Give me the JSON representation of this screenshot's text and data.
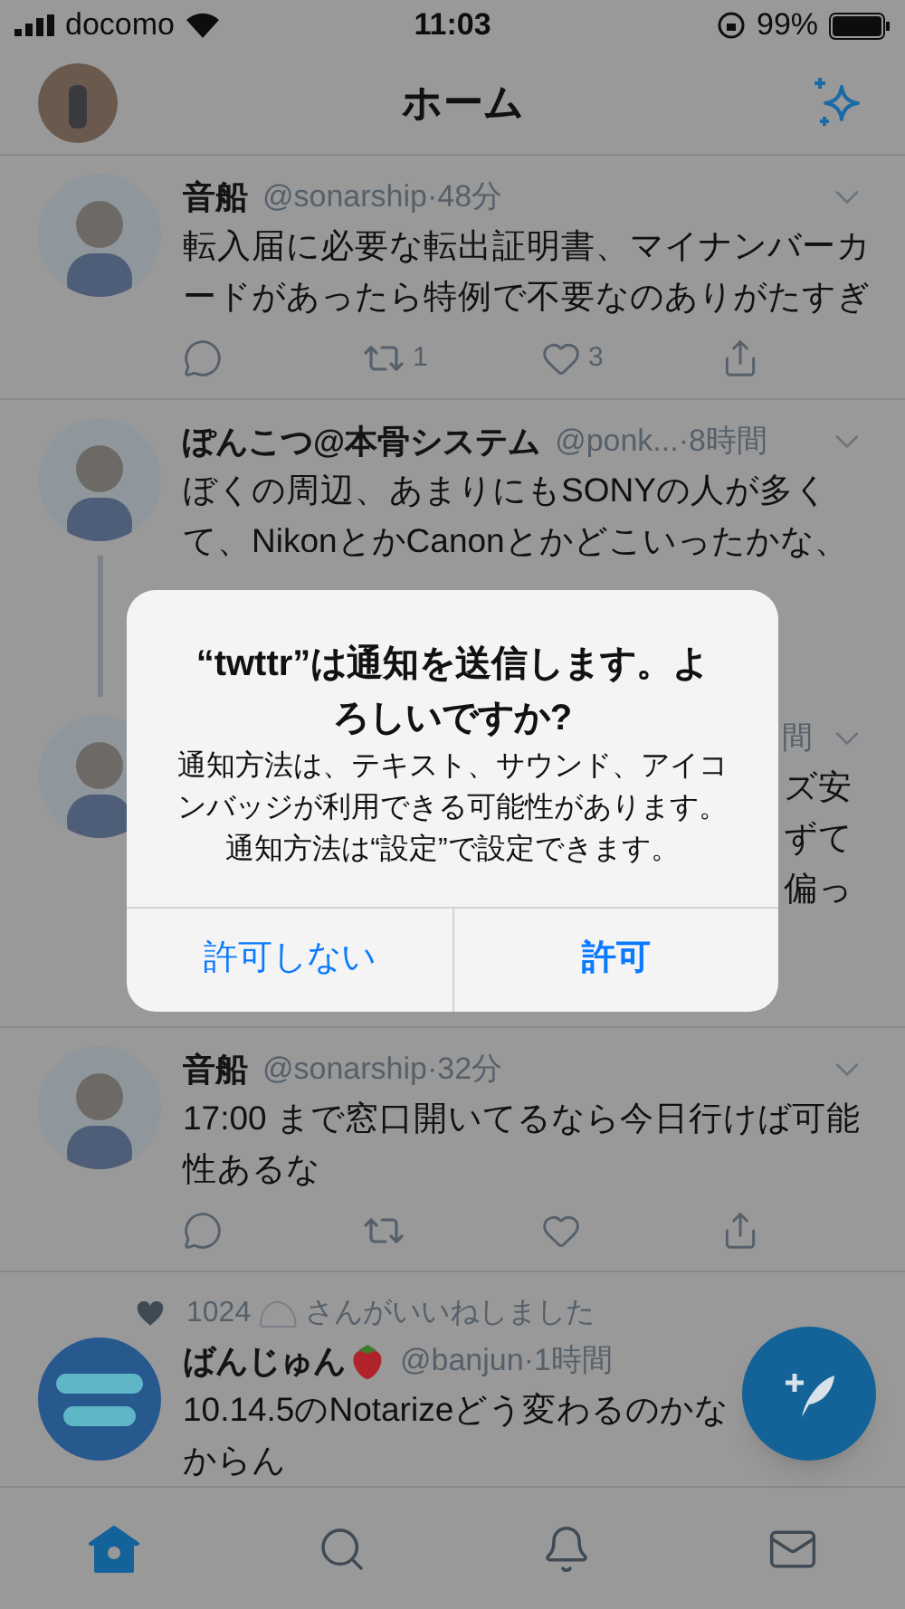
{
  "status_bar": {
    "carrier": "docomo",
    "time": "11:03",
    "battery": "99%"
  },
  "header": {
    "title": "ホーム"
  },
  "tweets": [
    {
      "kind": "full",
      "name": "音船",
      "handle": "@sonarship",
      "time": "·48分",
      "lines": [
        "転入届に必要な転出証明書、マイナンバーカ",
        "ードがあったら特例で不要なのありがたすぎ"
      ],
      "thread": false,
      "retweets": "1",
      "likes": "3"
    },
    {
      "kind": "full",
      "name": "ぽんこつ@本骨システム",
      "handle": "@ponk...",
      "time": "·8時間",
      "lines": [
        "ぼくの周辺、あまりにもSONYの人が多く",
        "て、NikonとかCanonとかどこいったかな、"
      ],
      "thread": true
    },
    {
      "kind": "obscured",
      "time": "間",
      "lines": [
        "ズ安",
        "ずて",
        "偏っ"
      ],
      "thread": false
    },
    {
      "kind": "full",
      "name": "音船",
      "handle": "@sonarship",
      "time": "·32分",
      "lines": [
        "17:00 まで窓口開いてるなら今日行けば可能",
        "性あるな"
      ],
      "thread": false
    },
    {
      "kind": "liked",
      "liked_count": "1024",
      "liked_text": "さんがいいねしました",
      "name": "ばんじゅん",
      "handle": "@banjun",
      "time": "·1時間",
      "lines": [
        "10.14.5のNotarizeどう変わるのかな",
        "からん"
      ],
      "thread": false
    }
  ],
  "dialog": {
    "title": "“twttr”は通知を送信します。よろしいですか?",
    "message_lines": [
      "通知方法は、テキスト、サウンド、アイコンバッジが利用できる可能性があります。",
      "通知方法は“設定”で設定できます。"
    ],
    "buttons": [
      {
        "label": "許可しない",
        "default": false
      },
      {
        "label": "許可",
        "default": true
      }
    ]
  },
  "tabs": [
    {
      "kind": "home",
      "selected": true
    },
    {
      "kind": "search",
      "selected": false
    },
    {
      "kind": "notifications",
      "selected": false
    },
    {
      "kind": "messages",
      "selected": false
    }
  ]
}
